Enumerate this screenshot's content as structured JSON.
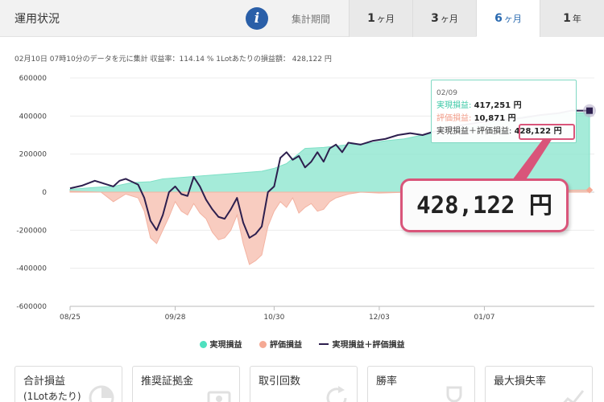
{
  "header": {
    "title": "運用状況",
    "period_label": "集計期間",
    "tabs": [
      {
        "num": "1",
        "unit": "ヶ月",
        "active": false
      },
      {
        "num": "3",
        "unit": "ヶ月",
        "active": false
      },
      {
        "num": "6",
        "unit": "ヶ月",
        "active": true
      },
      {
        "num": "1",
        "unit": "年",
        "active": false
      }
    ]
  },
  "summary": "02月10日 07時10分のデータを元に集計 収益率：114.14 % 1Lotあたりの損益額： 428,122 円",
  "chart_data": {
    "type": "area",
    "x_tick_labels": [
      "08/25",
      "09/28",
      "10/30",
      "12/03",
      "01/07"
    ],
    "x_tick_positions": [
      0,
      34,
      66,
      100,
      134
    ],
    "x_max": 168,
    "ylim": [
      -600000,
      600000
    ],
    "y_ticks": [
      600000,
      400000,
      200000,
      0,
      -200000,
      -400000,
      -600000
    ],
    "y_tick_labels": [
      "600000",
      "400000",
      "200000",
      "0",
      "-200000",
      "-400000",
      "-600000"
    ],
    "colors": {
      "realized": "#8fe6d0",
      "unrealized": "#f7c3b5",
      "total": "#2d1f4e"
    },
    "series": [
      {
        "name": "実現損益",
        "points": [
          [
            0,
            15000
          ],
          [
            8,
            25000
          ],
          [
            14,
            30000
          ],
          [
            20,
            50000
          ],
          [
            26,
            55000
          ],
          [
            30,
            70000
          ],
          [
            38,
            80000
          ],
          [
            46,
            90000
          ],
          [
            54,
            100000
          ],
          [
            62,
            110000
          ],
          [
            66,
            125000
          ],
          [
            70,
            150000
          ],
          [
            76,
            230000
          ],
          [
            82,
            235000
          ],
          [
            90,
            250000
          ],
          [
            96,
            255000
          ],
          [
            102,
            270000
          ],
          [
            108,
            280000
          ],
          [
            114,
            300000
          ],
          [
            120,
            320000
          ],
          [
            126,
            340000
          ],
          [
            132,
            350000
          ],
          [
            140,
            380000
          ],
          [
            148,
            400000
          ],
          [
            156,
            410000
          ],
          [
            162,
            417251
          ],
          [
            168,
            417251
          ]
        ]
      },
      {
        "name": "評価損益",
        "points": [
          [
            0,
            5000
          ],
          [
            10,
            0
          ],
          [
            14,
            -50000
          ],
          [
            18,
            -10000
          ],
          [
            22,
            -30000
          ],
          [
            24,
            -100000
          ],
          [
            26,
            -240000
          ],
          [
            28,
            -270000
          ],
          [
            30,
            -200000
          ],
          [
            32,
            -130000
          ],
          [
            34,
            -50000
          ],
          [
            36,
            -100000
          ],
          [
            38,
            -120000
          ],
          [
            40,
            -60000
          ],
          [
            42,
            -110000
          ],
          [
            44,
            -140000
          ],
          [
            46,
            -210000
          ],
          [
            48,
            -250000
          ],
          [
            50,
            -240000
          ],
          [
            52,
            -200000
          ],
          [
            54,
            -120000
          ],
          [
            56,
            -270000
          ],
          [
            58,
            -380000
          ],
          [
            60,
            -360000
          ],
          [
            62,
            -330000
          ],
          [
            64,
            -180000
          ],
          [
            66,
            -100000
          ],
          [
            68,
            -50000
          ],
          [
            70,
            -80000
          ],
          [
            72,
            -30000
          ],
          [
            74,
            -110000
          ],
          [
            76,
            -80000
          ],
          [
            78,
            -60000
          ],
          [
            80,
            -100000
          ],
          [
            82,
            -90000
          ],
          [
            84,
            -50000
          ],
          [
            86,
            -30000
          ],
          [
            90,
            -10000
          ],
          [
            94,
            0
          ],
          [
            100,
            -5000
          ],
          [
            110,
            0
          ],
          [
            120,
            5000
          ],
          [
            130,
            10000
          ],
          [
            140,
            5000
          ],
          [
            150,
            8000
          ],
          [
            160,
            10000
          ],
          [
            164,
            10871
          ],
          [
            168,
            10871
          ]
        ]
      },
      {
        "name": "実現損益＋評価損益",
        "points": [
          [
            0,
            20000
          ],
          [
            4,
            35000
          ],
          [
            8,
            60000
          ],
          [
            12,
            40000
          ],
          [
            14,
            30000
          ],
          [
            16,
            60000
          ],
          [
            18,
            70000
          ],
          [
            20,
            55000
          ],
          [
            22,
            40000
          ],
          [
            24,
            -30000
          ],
          [
            26,
            -150000
          ],
          [
            28,
            -200000
          ],
          [
            30,
            -120000
          ],
          [
            32,
            0
          ],
          [
            34,
            30000
          ],
          [
            36,
            -10000
          ],
          [
            38,
            -20000
          ],
          [
            40,
            80000
          ],
          [
            42,
            30000
          ],
          [
            44,
            -40000
          ],
          [
            46,
            -90000
          ],
          [
            48,
            -130000
          ],
          [
            50,
            -140000
          ],
          [
            52,
            -90000
          ],
          [
            54,
            -30000
          ],
          [
            56,
            -160000
          ],
          [
            58,
            -240000
          ],
          [
            60,
            -220000
          ],
          [
            62,
            -180000
          ],
          [
            64,
            0
          ],
          [
            66,
            30000
          ],
          [
            68,
            180000
          ],
          [
            70,
            210000
          ],
          [
            72,
            170000
          ],
          [
            74,
            190000
          ],
          [
            76,
            130000
          ],
          [
            78,
            160000
          ],
          [
            80,
            210000
          ],
          [
            82,
            160000
          ],
          [
            84,
            230000
          ],
          [
            86,
            250000
          ],
          [
            88,
            210000
          ],
          [
            90,
            260000
          ],
          [
            94,
            250000
          ],
          [
            98,
            270000
          ],
          [
            102,
            280000
          ],
          [
            106,
            300000
          ],
          [
            110,
            310000
          ],
          [
            114,
            300000
          ],
          [
            118,
            320000
          ],
          [
            122,
            330000
          ],
          [
            126,
            350000
          ],
          [
            130,
            360000
          ],
          [
            134,
            370000
          ],
          [
            140,
            380000
          ],
          [
            146,
            390000
          ],
          [
            152,
            405000
          ],
          [
            158,
            415000
          ],
          [
            162,
            428122
          ],
          [
            168,
            428122
          ]
        ]
      }
    ]
  },
  "legend": [
    {
      "label": "実現損益",
      "kind": "dot",
      "color": "#4fe0bf"
    },
    {
      "label": "評価損益",
      "kind": "dot",
      "color": "#f5a994"
    },
    {
      "label": "実現損益＋評価損益",
      "kind": "line",
      "color": "#2d1f4e"
    }
  ],
  "tooltip": {
    "date": "02/09",
    "realized_label": "実現損益:",
    "realized_value": "417,251 円",
    "unrealized_label": "評価損益:",
    "unrealized_value": "10,871 円",
    "total_label": "実現損益＋評価損益:",
    "total_value": "428,122 円"
  },
  "callout": "428,122 円",
  "cards": [
    {
      "label": "合計損益",
      "sub": "(1Lotあたり)",
      "icon": "pie-chart-icon"
    },
    {
      "label": "推奨証拠金",
      "sub": "",
      "icon": "money-icon"
    },
    {
      "label": "取引回数",
      "sub": "",
      "icon": "refresh-icon"
    },
    {
      "label": "勝率",
      "sub": "",
      "icon": "trophy-icon"
    },
    {
      "label": "最大損失率",
      "sub": "",
      "icon": "trend-icon"
    }
  ]
}
